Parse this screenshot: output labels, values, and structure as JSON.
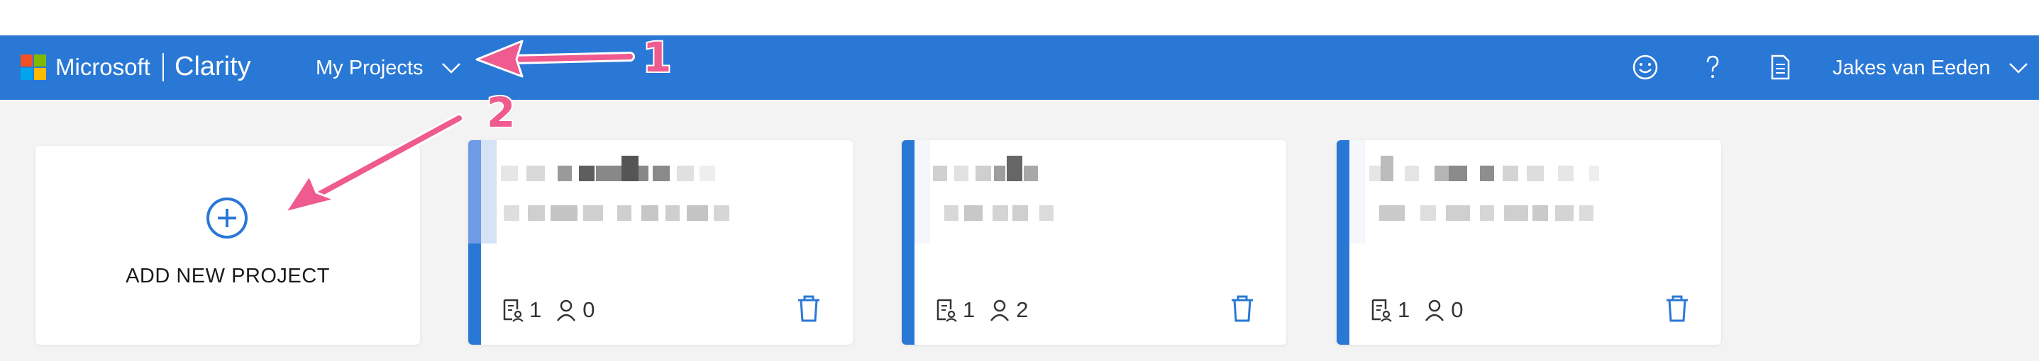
{
  "header": {
    "brand": "Microsoft",
    "product": "Clarity",
    "projects_menu": "My Projects",
    "user_name": "Jakes van Eeden",
    "icons": [
      "feedback-smiley-icon",
      "help-icon",
      "document-icon",
      "chevron-down-icon"
    ],
    "bg_color": "#2a78d6"
  },
  "annotations": {
    "label_1": "1",
    "label_2": "2",
    "color": "#ef5a8f"
  },
  "add_project": {
    "label": "ADD NEW PROJECT",
    "icon": "plus-circle-icon"
  },
  "projects": [
    {
      "name": "",
      "url": "",
      "recordings": "1",
      "members": "0"
    },
    {
      "name": "",
      "url": "",
      "recordings": "1",
      "members": "2"
    },
    {
      "name": "",
      "url": "",
      "recordings": "1",
      "members": "0"
    }
  ]
}
